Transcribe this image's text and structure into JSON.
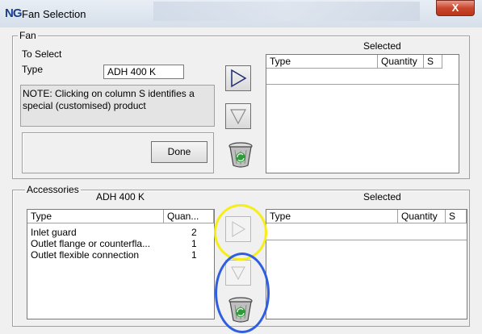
{
  "window": {
    "logo": "NG",
    "title": "Fan Selection",
    "close_glyph": "X"
  },
  "fan": {
    "legend": "Fan",
    "to_select_label": "To Select",
    "type_label": "Type",
    "type_value": "ADH 400 K",
    "note": "NOTE: Clicking on column S identifies a special (customised) product",
    "done_label": "Done",
    "selected_label": "Selected",
    "selected_columns": [
      "Type",
      "Quantity",
      "S"
    ]
  },
  "accessories": {
    "legend": "Accessories",
    "model": "ADH 400 K",
    "selected_label": "Selected",
    "columns": [
      "Type",
      "Quan..."
    ],
    "items": [
      {
        "type": "Inlet guard",
        "quantity": "2"
      },
      {
        "type": "Outlet flange or counterfla...",
        "quantity": "1"
      },
      {
        "type": "Outlet flexible connection",
        "quantity": "1"
      }
    ],
    "selected_columns": [
      "Type",
      "Quantity",
      "S"
    ]
  },
  "icons": {
    "add": "play-right-icon",
    "remove": "play-down-icon",
    "delete": "recycle-bin-icon"
  },
  "highlight_colors": {
    "yellow": "#f5ee1a",
    "blue": "#2f5fe0"
  }
}
